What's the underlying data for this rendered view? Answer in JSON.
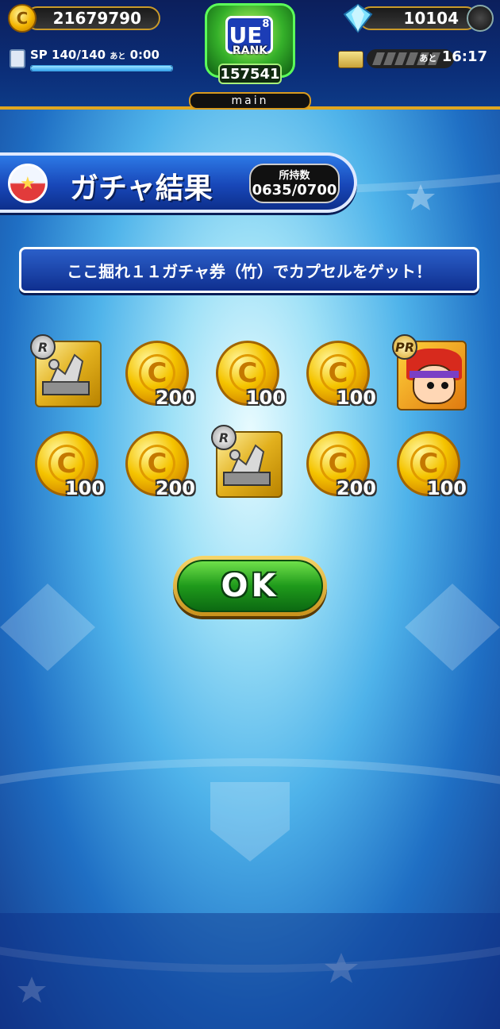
{
  "hud": {
    "coins": "21679790",
    "coin_icon": "coin-icon",
    "gems": "10104",
    "gem_icon": "diamond-icon",
    "sp_text": "SP 140/140",
    "sp_remaining_label": "あと",
    "sp_time": "0:00",
    "sp_fill_fraction": 1.0,
    "stamina_remaining_label": "あと",
    "stamina_time": "16:17",
    "rank_letter": "UE",
    "rank_sub": "8",
    "rank_label": "RANK",
    "rank_value": "157541",
    "mode_label": "main"
  },
  "title": {
    "text": "ガチャ結果",
    "owned_label": "所持数",
    "owned_value": "0635/0700"
  },
  "message": "ここ掘れ１１ガチャ券（竹）でカプセルをゲット！",
  "items": [
    {
      "kind": "statue",
      "rarity": "R"
    },
    {
      "kind": "coin",
      "amount": "200"
    },
    {
      "kind": "coin",
      "amount": "100"
    },
    {
      "kind": "coin",
      "amount": "100"
    },
    {
      "kind": "character",
      "rarity": "PR"
    },
    {
      "kind": "coin",
      "amount": "100"
    },
    {
      "kind": "coin",
      "amount": "200"
    },
    {
      "kind": "statue",
      "rarity": "R"
    },
    {
      "kind": "coin",
      "amount": "200"
    },
    {
      "kind": "coin",
      "amount": "100"
    }
  ],
  "ok_button": "OK",
  "colors": {
    "accent_gold": "#e0a620",
    "banner_blue": "#1847b8",
    "ok_green": "#1f9a1b"
  }
}
